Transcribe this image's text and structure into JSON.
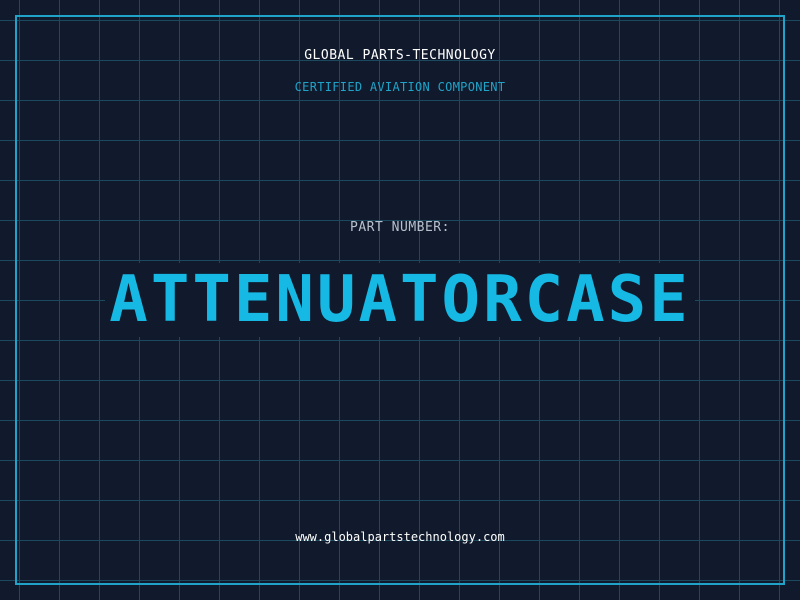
{
  "header": {
    "company": "GLOBAL PARTS-TECHNOLOGY",
    "subtitle": "CERTIFIED AVIATION COMPONENT"
  },
  "part": {
    "label": "PART NUMBER:",
    "number": "ATTENUATORCASE"
  },
  "footer": {
    "url": "www.globalpartstechnology.com"
  },
  "colors": {
    "background": "#101a2c",
    "grid": "#1b4a5e",
    "accent": "#1fa3c8",
    "part_number": "#16b8e4"
  }
}
